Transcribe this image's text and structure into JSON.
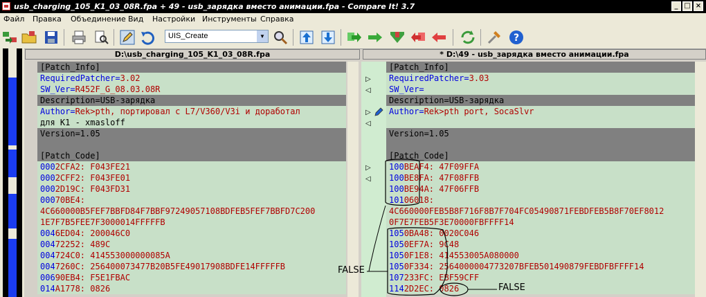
{
  "window": {
    "title": "usb_charging_105_K1_03_08R.fpa + 49 - usb_зарядка вместо анимации.fpa - Compare It! 3.7",
    "buttons": {
      "min": "_",
      "max": "□",
      "close": "×"
    }
  },
  "menu": [
    "Файл",
    "Правка",
    "Объединение",
    "Вид",
    "Настройки",
    "Инструменты",
    "Справка"
  ],
  "toolbar": {
    "combo_value": "UIS_Create"
  },
  "left": {
    "header": "D:\\usb_charging_105_K1_03_08R.fpa",
    "lines": [
      {
        "bg": "gray",
        "t": "[Patch_Info]"
      },
      {
        "bg": "green",
        "t": "RequiredPatcher=3.02"
      },
      {
        "bg": "green",
        "t": "SW_Ver=R452F_G_08.03.08R"
      },
      {
        "bg": "gray",
        "t": "Description=USB-зарядка"
      },
      {
        "bg": "green",
        "t": "Author=Rek>pth, портировал с L7/V360/V3i и доработал"
      },
      {
        "bg": "green",
        "t": "для K1 - xmasloff"
      },
      {
        "bg": "gray",
        "t": "Version=1.05"
      },
      {
        "bg": "gray",
        "t": ""
      },
      {
        "bg": "gray",
        "t": "[Patch_Code]"
      },
      {
        "bg": "green",
        "t": "0002CFA2: F043FE21"
      },
      {
        "bg": "green",
        "t": "0002CFF2: F043FE01"
      },
      {
        "bg": "green",
        "t": "0002D19C: F043FD31"
      },
      {
        "bg": "green",
        "t": "00070BE4:"
      },
      {
        "bg": "green",
        "t": "4C660000B5FEF7BBFD84F7BBF97249057108BDFEB5FEF7BBFD7C200"
      },
      {
        "bg": "green",
        "t": "1E7F7B5FEE7F3000014FFFFFB"
      },
      {
        "bg": "green",
        "t": "0046ED04: 200046C0"
      },
      {
        "bg": "green",
        "t": "00472252: 489C"
      },
      {
        "bg": "green",
        "t": "004724C0: 414553000000085A"
      },
      {
        "bg": "green",
        "t": "0047260C: 256400073477B20B5FE49017908BDFE14FFFFFB"
      },
      {
        "bg": "green",
        "t": "00690EB4: F5E1FBAC"
      },
      {
        "bg": "green",
        "t": "014A1778: 0826"
      }
    ]
  },
  "right": {
    "header": "* D:\\49 - usb_зарядка вместо анимации.fpa",
    "lines": [
      {
        "bg": "gray",
        "t": "[Patch_Info]"
      },
      {
        "bg": "green",
        "t": "RequiredPatcher=3.03"
      },
      {
        "bg": "green",
        "t": "SW_Ver="
      },
      {
        "bg": "gray",
        "t": "Description=USB-зарядка"
      },
      {
        "bg": "green",
        "t": "Author=Rek>pth port, SocaSlvr"
      },
      {
        "bg": "blank",
        "t": ""
      },
      {
        "bg": "gray",
        "t": "Version=1.05"
      },
      {
        "bg": "gray",
        "t": ""
      },
      {
        "bg": "gray",
        "t": "[Patch_Code]"
      },
      {
        "bg": "green",
        "t": "100BEAF4: 47F09FFA"
      },
      {
        "bg": "green",
        "t": "100BE8FA: 47F08FFB"
      },
      {
        "bg": "green",
        "t": "100BE94A: 47F06FFB"
      },
      {
        "bg": "green",
        "t": "10106018:"
      },
      {
        "bg": "green",
        "t": "4C660000FEB5B8F716F8B7F704FC05490871FEBDFEB5B8F70EF8012"
      },
      {
        "bg": "green",
        "t": "0F7E7FEB5F3E70000FBFFFF14"
      },
      {
        "bg": "green",
        "t": "1050BA48: 0020C046"
      },
      {
        "bg": "green",
        "t": "1050EF7A: 9C48"
      },
      {
        "bg": "green",
        "t": "1050F1E8: 414553005A080000"
      },
      {
        "bg": "green",
        "t": "1050F334: 2564000004773207BFEB501490879FEBDFBFFFF14"
      },
      {
        "bg": "green",
        "t": "107233FC: EBF59CFF"
      },
      {
        "bg": "green",
        "t": "1142D2EC: 0826"
      }
    ]
  },
  "annotations": {
    "false1": "FALSE",
    "false2": "FALSE"
  }
}
